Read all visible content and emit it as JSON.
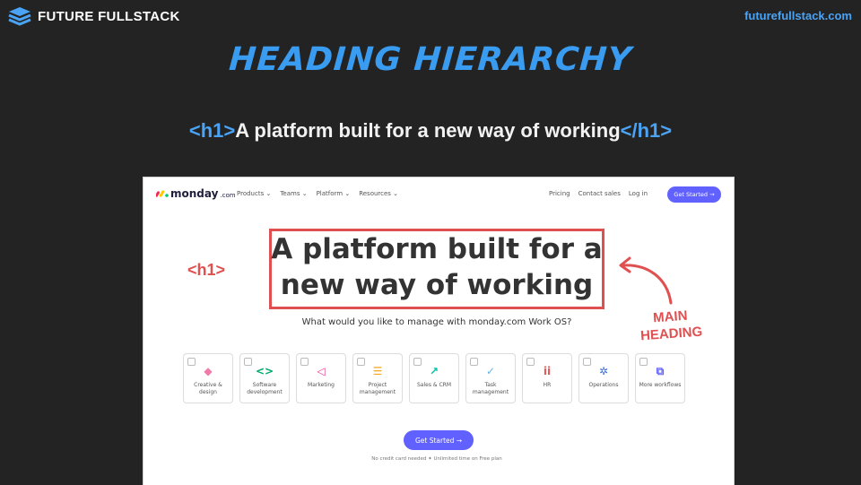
{
  "header": {
    "brand_name": "FUTURE FULLSTACK",
    "site_url": "futurefullstack.com"
  },
  "slide": {
    "title": "HEADING HIERARCHY",
    "h1_open_tag": "<h1>",
    "h1_text": "A platform built for a new way of working",
    "h1_close_tag": "</h1>"
  },
  "screenshot": {
    "logo_word": "monday",
    "logo_suffix": ".com",
    "nav_menu": [
      "Products ⌄",
      "Teams ⌄",
      "Platform ⌄",
      "Resources ⌄"
    ],
    "nav_right": [
      "Pricing",
      "Contact sales",
      "Log in"
    ],
    "nav_cta": "Get Started →",
    "hero_line1": "A platform built for a",
    "hero_line2": "new way of working",
    "subtitle": "What would you like to manage with monday.com Work OS?",
    "cards": [
      {
        "label": "Creative & design",
        "icon": "shapes-icon",
        "glyph": "◆",
        "color": "#f07aa8"
      },
      {
        "label": "Software development",
        "icon": "code-icon",
        "glyph": "<>",
        "color": "#00a86b"
      },
      {
        "label": "Marketing",
        "icon": "megaphone-icon",
        "glyph": "◁",
        "color": "#e8338f"
      },
      {
        "label": "Project management",
        "icon": "list-icon",
        "glyph": "☰",
        "color": "#f5a623"
      },
      {
        "label": "Sales & CRM",
        "icon": "trend-up-icon",
        "glyph": "↗",
        "color": "#00c2a8"
      },
      {
        "label": "Task management",
        "icon": "check-icon",
        "glyph": "✓",
        "color": "#66b3e8"
      },
      {
        "label": "HR",
        "icon": "people-icon",
        "glyph": "ii",
        "color": "#e85a5a"
      },
      {
        "label": "Operations",
        "icon": "gears-icon",
        "glyph": "✲",
        "color": "#3b6fd9"
      },
      {
        "label": "More workflows",
        "icon": "stack-icon",
        "glyph": "⧉",
        "color": "#6161ff"
      }
    ],
    "main_cta": "Get Started →",
    "footnote": "No credit card needed   ✦   Unlimited time on Free plan"
  },
  "annotations": {
    "h1_label": "<h1>",
    "main_heading_line1": "MAIN",
    "main_heading_line2": "HEADING"
  },
  "colors": {
    "background": "#232323",
    "accent_blue": "#3a9cf0",
    "annotation_red": "#e05050",
    "monday_purple": "#6161ff"
  }
}
